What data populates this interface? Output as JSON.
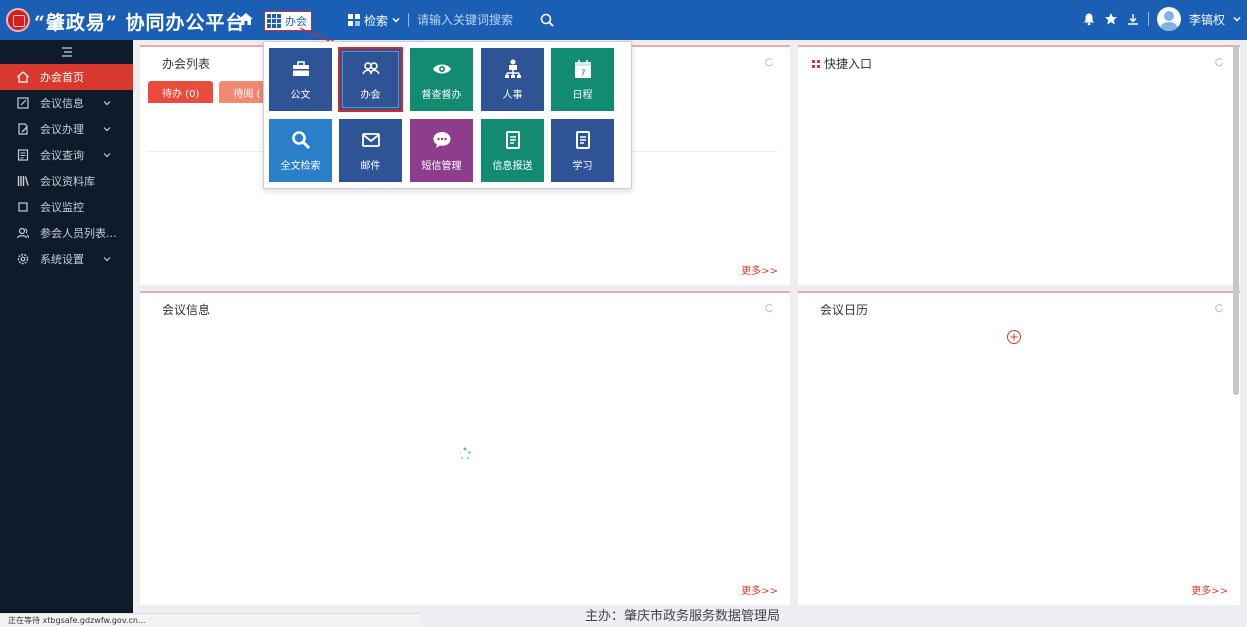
{
  "header": {
    "brand": "“肇政易” 协同办公平台",
    "module_label": "办会",
    "search_category": "检索",
    "search_placeholder": "请输入关键词搜索",
    "username": "李镐权"
  },
  "sidebar": {
    "items": [
      {
        "label": "办会首页",
        "icon": "home-icon",
        "active": true,
        "has_children": false
      },
      {
        "label": "会议信息",
        "icon": "edit-square-icon",
        "active": false,
        "has_children": true
      },
      {
        "label": "会议办理",
        "icon": "pencil-doc-icon",
        "active": false,
        "has_children": true
      },
      {
        "label": "会议查询",
        "icon": "list-doc-icon",
        "active": false,
        "has_children": true
      },
      {
        "label": "会议资料库",
        "icon": "library-icon",
        "active": false,
        "has_children": false
      },
      {
        "label": "会议监控",
        "icon": "monitor-icon",
        "active": false,
        "has_children": false
      },
      {
        "label": "参会人员列表...",
        "icon": "users-icon",
        "active": false,
        "has_children": false
      },
      {
        "label": "系统设置",
        "icon": "gear-icon",
        "active": false,
        "has_children": true
      }
    ]
  },
  "panels": {
    "meeting_list": {
      "title": "办会列表",
      "tab1": "待办 (0)",
      "tab2": "待阅 (",
      "more": "更多>>"
    },
    "quick_entry": {
      "title": "快捷入口"
    },
    "meeting_info": {
      "title": "会议信息",
      "more": "更多>>"
    },
    "meeting_calendar": {
      "title": "会议日历",
      "more": "更多>>"
    }
  },
  "app_menu": {
    "tiles": [
      {
        "label": "公文",
        "icon": "briefcase-icon",
        "color": "#2f5496"
      },
      {
        "label": "办会",
        "icon": "group-icon",
        "color": "#2f5496",
        "selected": true
      },
      {
        "label": "督查督办",
        "icon": "eye-icon",
        "color": "#138a72"
      },
      {
        "label": "人事",
        "icon": "org-chart-icon",
        "color": "#2f5496"
      },
      {
        "label": "日程",
        "icon": "calendar-icon",
        "color": "#138a72"
      },
      {
        "label": "全文检索",
        "icon": "search-icon",
        "color": "#2a7fc8"
      },
      {
        "label": "邮件",
        "icon": "mail-icon",
        "color": "#2f5496"
      },
      {
        "label": "短信管理",
        "icon": "chat-icon",
        "color": "#8e3c8c"
      },
      {
        "label": "信息报送",
        "icon": "doc-icon",
        "color": "#138a72"
      },
      {
        "label": "学习",
        "icon": "doc-icon",
        "color": "#2f5496"
      }
    ],
    "calendar_day": "7"
  },
  "footer": {
    "sponsor": "主办：肇庆市政务服务数据管理局",
    "status": "正在等待 xtbgsafe.gdzwfw.gov.cn..."
  },
  "colors": {
    "topbar": "#1a5fb4",
    "sidebar": "#0f1a2a",
    "accent": "#d9382f"
  }
}
